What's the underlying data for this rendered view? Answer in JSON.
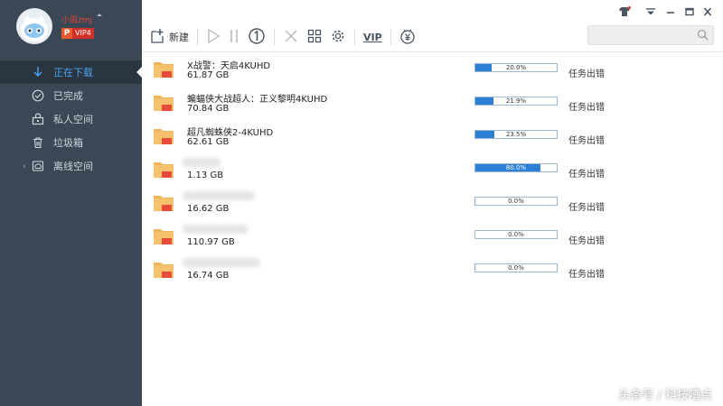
{
  "user": {
    "name": "小周zmj",
    "badge_letter": "P",
    "vip_label": "VIP4"
  },
  "sidebar": {
    "items": [
      {
        "label": "正在下载",
        "icon": "download-arrow-icon",
        "active": true
      },
      {
        "label": "已完成",
        "icon": "check-circle-icon",
        "active": false
      },
      {
        "label": "私人空间",
        "icon": "lock-box-icon",
        "active": false
      },
      {
        "label": "垃圾箱",
        "icon": "trash-icon",
        "active": false
      },
      {
        "label": "离线空间",
        "icon": "cloud-offline-icon",
        "active": false
      }
    ]
  },
  "toolbar": {
    "new_label": "新建",
    "vip_label": "VIP"
  },
  "search": {
    "placeholder": ""
  },
  "tasks": [
    {
      "name": "X战警：天启4KUHD",
      "size": "61.87 GB",
      "progress": 20.0,
      "progress_label": "20.0%",
      "status": "任务出错"
    },
    {
      "name": "蝙蝠侠大战超人：正义黎明4KUHD",
      "size": "70.84 GB",
      "progress": 21.9,
      "progress_label": "21.9%",
      "status": "任务出错"
    },
    {
      "name": "超凡蜘蛛侠2-4KUHD",
      "size": "62.61 GB",
      "progress": 23.5,
      "progress_label": "23.5%",
      "status": "任务出错"
    },
    {
      "name": "",
      "size": "1.13 GB",
      "progress": 80.0,
      "progress_label": "80.0%",
      "status": "任务出错"
    },
    {
      "name": "",
      "size": "16.62 GB",
      "progress": 0.0,
      "progress_label": "0.0%",
      "status": "任务出错"
    },
    {
      "name": "",
      "size": "110.97 GB",
      "progress": 0.0,
      "progress_label": "0.0%",
      "status": "任务出错"
    },
    {
      "name": "",
      "size": "16.74 GB",
      "progress": 0.0,
      "progress_label": "0.0%",
      "status": "任务出错"
    }
  ],
  "file_badge": "BT",
  "watermark": "头条号 / 科技嘈点",
  "colors": {
    "sidebar_bg": "#3a4855",
    "accent": "#2b80d6",
    "active_text": "#4aa3f0",
    "vip_red": "#d2302a"
  }
}
